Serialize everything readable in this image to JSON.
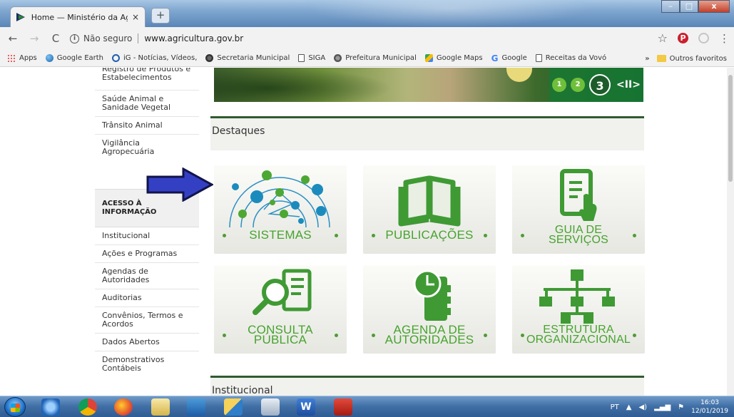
{
  "browser": {
    "tab_title": "Home — Ministério da Agricultu",
    "tab_close": "×",
    "new_tab": "+",
    "window_controls": {
      "minimize": "–",
      "maximize": "□",
      "close": "x"
    },
    "nav": {
      "back": "←",
      "forward": "→",
      "reload": "C"
    },
    "security_label": "Não seguro",
    "url": "www.agricultura.gov.br",
    "info_glyph": "i",
    "pinterest_glyph": "P",
    "menu_glyph": "⋮",
    "star_glyph": "☆"
  },
  "bookmarks": {
    "items": [
      {
        "label": "Apps",
        "icon": "apps-icon"
      },
      {
        "label": "Google Earth",
        "icon": "globe-icon"
      },
      {
        "label": "iG - Notícias, Vídeos,",
        "icon": "ig-icon"
      },
      {
        "label": "Secretaria Municipal",
        "icon": "secretaria-icon"
      },
      {
        "label": "SIGA",
        "icon": "document-icon"
      },
      {
        "label": "Prefeitura Municipal",
        "icon": "prefeitura-icon"
      },
      {
        "label": "Google Maps",
        "icon": "maps-icon"
      },
      {
        "label": "Google",
        "icon": "google-icon",
        "glyph": "G"
      },
      {
        "label": "Receitas da Vovó",
        "icon": "document-icon"
      }
    ],
    "overflow": "»",
    "other_label": "Outros favoritos"
  },
  "sidebar": {
    "top_items": [
      "Registro de Produtos e Estabelecimentos",
      "Saúde Animal e Sanidade Vegetal",
      "Trânsito Animal",
      "Vigilância Agropecuária"
    ],
    "section_title": "ACESSO À INFORMAÇÃO",
    "section_items": [
      "Institucional",
      "Ações e Programas",
      "Agendas de Autoridades",
      "Auditorias",
      "Convênios, Termos e Acordos",
      "Dados Abertos",
      "Demonstrativos Contábeis"
    ]
  },
  "slider": {
    "pages": [
      "1",
      "2",
      "3"
    ],
    "active_page": "3",
    "controls": "<II>"
  },
  "destaques": {
    "title": "Destaques",
    "cards": [
      {
        "label": "SISTEMAS",
        "icon": "network-icon"
      },
      {
        "label": "PUBLICAÇÕES",
        "icon": "book-icon"
      },
      {
        "label": "GUIA DE SERVIÇOS",
        "icon": "guide-document-icon"
      },
      {
        "label": "CONSULTA PÚBLICA",
        "icon": "magnifier-document-icon"
      },
      {
        "label": "AGENDA DE AUTORIDADES",
        "icon": "agenda-clock-icon"
      },
      {
        "label": "ESTRUTURA ORGANIZACIONAL",
        "icon": "org-chart-icon"
      }
    ]
  },
  "institucional": {
    "title": "Institucional"
  },
  "taskbar": {
    "language": "PT",
    "time": "16:03",
    "date": "12/01/2019"
  },
  "colors": {
    "accent_green": "#47a32f",
    "dark_green": "#2f5b2f",
    "arrow_blue": "#3440c4"
  }
}
